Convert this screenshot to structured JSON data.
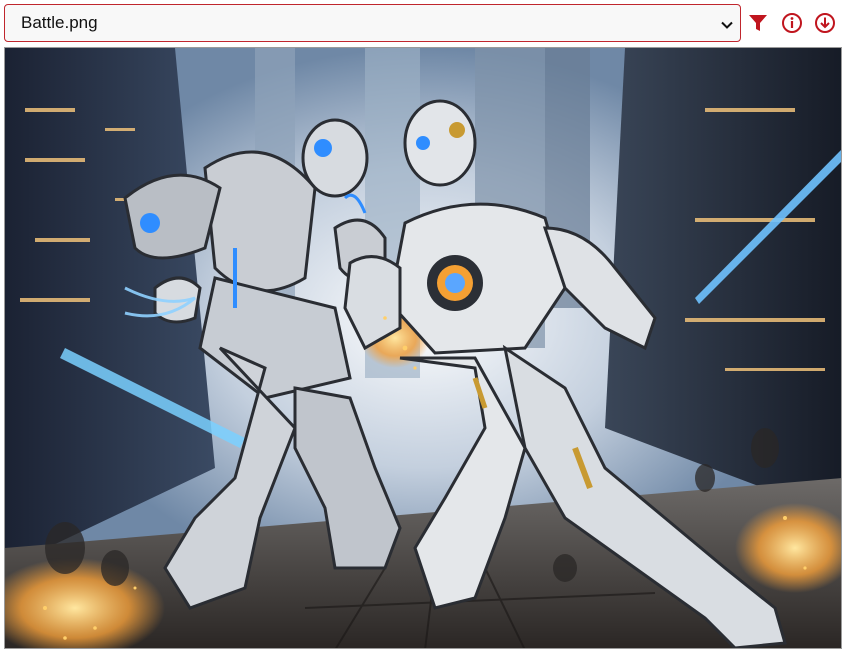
{
  "file_picker": {
    "selected": "Battle.png"
  },
  "toolbar": {
    "filter_icon": "filter-icon",
    "info_icon": "info-icon",
    "download_icon": "download-icon"
  },
  "colors": {
    "accent": "#c0151e",
    "border": "#c0262d"
  },
  "image": {
    "description_icon": "battle-image"
  }
}
